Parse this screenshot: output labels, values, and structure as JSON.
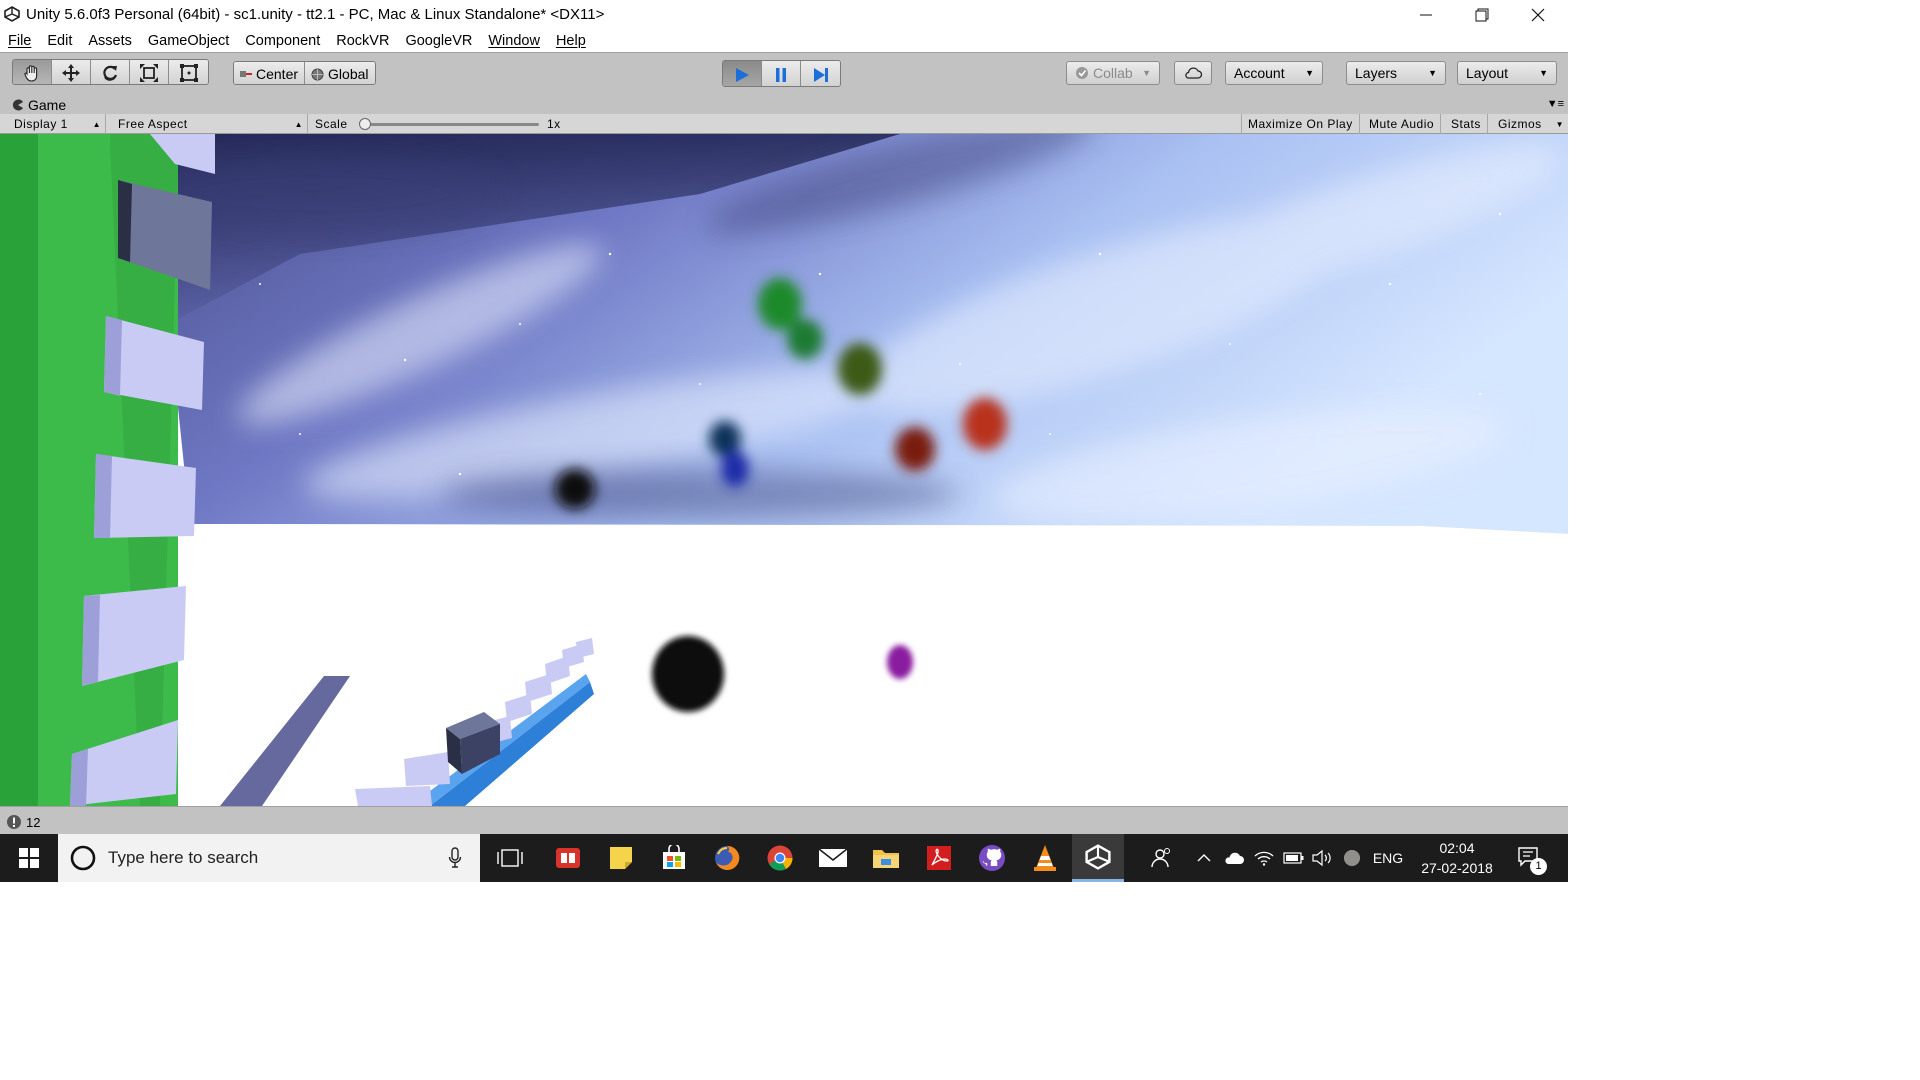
{
  "window": {
    "title": "Unity 5.6.0f3 Personal (64bit) - sc1.unity - tt2.1 - PC, Mac & Linux Standalone* <DX11>",
    "controls": [
      "minimize-icon",
      "restore-icon",
      "close-icon"
    ]
  },
  "menu": {
    "items": [
      "File",
      "Edit",
      "Assets",
      "GameObject",
      "Component",
      "RockVR",
      "GoogleVR",
      "Window",
      "Help"
    ]
  },
  "toolbar": {
    "tools": [
      "hand-icon",
      "move-icon",
      "rotate-icon",
      "scale-icon",
      "rect-tool-icon"
    ],
    "pivot_label": "Center",
    "space_label": "Global",
    "play_state": "playing",
    "collab_label": "Collab",
    "account_label": "Account",
    "layers_label": "Layers",
    "layout_label": "Layout"
  },
  "game_panel": {
    "tab_label": "Game",
    "display_label": "Display 1",
    "aspect_label": "Free Aspect",
    "scale_label": "Scale",
    "scale_value": "1x",
    "maximize_label": "Maximize On Play",
    "mute_label": "Mute Audio",
    "stats_label": "Stats",
    "gizmos_label": "Gizmos"
  },
  "status": {
    "count": "12"
  },
  "taskbar": {
    "search_placeholder": "Type here to search",
    "language": "ENG",
    "time": "02:04",
    "date": "27-02-2018",
    "notification_count": "1",
    "colors": {
      "bg": "#1c1c1c",
      "accent": "#8ab4e8"
    }
  },
  "colors": {
    "editor_gray": "#c2c2c2",
    "play_blue": "#1a6fd8",
    "wall_green": "#3dbb4a",
    "block_lavender": "#c9cbf5",
    "floor_blue": "#2e7fd8"
  }
}
